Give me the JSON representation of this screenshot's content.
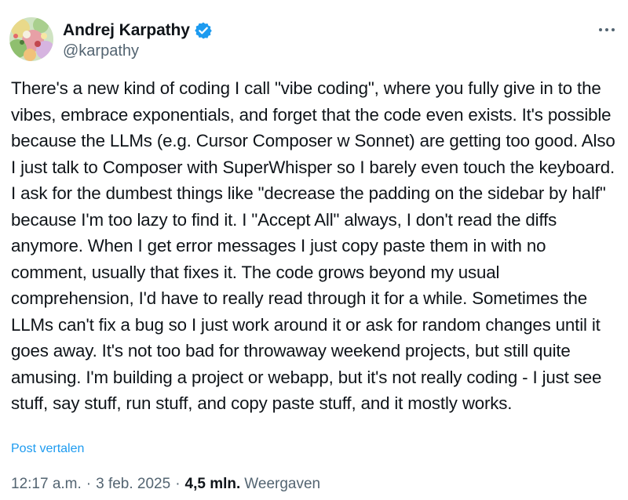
{
  "author": {
    "name": "Andrej Karpathy",
    "handle": "@karpathy",
    "verified": true,
    "avatar_icon": "avatar-illustration-icon"
  },
  "menu_icon": "more-options-icon",
  "tweet": {
    "text": "There's a new kind of coding I call \"vibe coding\", where you fully give in to the vibes, embrace exponentials, and forget that the code even exists. It's possible because the LLMs (e.g. Cursor Composer w Sonnet) are getting too good. Also I just talk to Composer with SuperWhisper so I barely even touch the keyboard. I ask for the dumbest things like \"decrease the padding on the sidebar by half\" because I'm too lazy to find it. I \"Accept All\" always, I don't read the diffs anymore. When I get error messages I just copy paste them in with no comment, usually that fixes it. The code grows beyond my usual comprehension, I'd have to really read through it for a while. Sometimes the LLMs can't fix a bug so I just work around it or ask for random changes until it goes away. It's not too bad for throwaway weekend projects, but still quite amusing. I'm building a project or webapp, but it's not really coding - I just see stuff, say stuff, run stuff, and copy paste stuff, and it mostly works.",
    "translate_label": "Post vertalen"
  },
  "meta": {
    "time": "12:17 a.m.",
    "separator": "·",
    "date": "3 feb. 2025",
    "views_count": "4,5 mln.",
    "views_label": "Weergaven"
  },
  "colors": {
    "text": "#0f1419",
    "secondary": "#536471",
    "accent": "#1d9bf0"
  }
}
